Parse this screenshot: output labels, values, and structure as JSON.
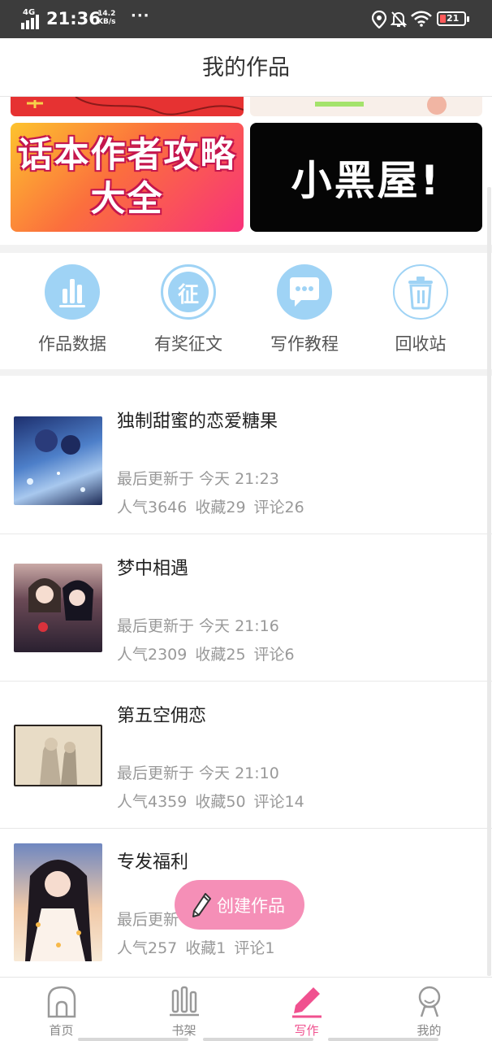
{
  "status_bar": {
    "network": "4G",
    "time": "21:36",
    "speed_value": "14.2",
    "speed_unit": "KB/s",
    "dots": "···",
    "battery": "21"
  },
  "header": {
    "title": "我的作品"
  },
  "banners": {
    "guide_line1": "话本作者攻略",
    "guide_line2": "大全",
    "dark_text": "小黑屋!"
  },
  "actions": [
    {
      "label": "作品数据",
      "icon": "bar-chart-icon"
    },
    {
      "label": "有奖征文",
      "icon": "contest-icon",
      "glyph": "征"
    },
    {
      "label": "写作教程",
      "icon": "chat-bubble-icon"
    },
    {
      "label": "回收站",
      "icon": "trash-icon"
    }
  ],
  "works": [
    {
      "title": "独制甜蜜的恋爱糖果",
      "updated": "最后更新于 今天 21:23",
      "popularity": "人气3646",
      "favorites": "收藏29",
      "comments": "评论26"
    },
    {
      "title": "梦中相遇",
      "updated": "最后更新于 今天 21:16",
      "popularity": "人气2309",
      "favorites": "收藏25",
      "comments": "评论6"
    },
    {
      "title": "第五空佣恋",
      "updated": "最后更新于 今天 21:10",
      "popularity": "人气4359",
      "favorites": "收藏50",
      "comments": "评论14"
    },
    {
      "title": "专发福利",
      "updated": "最后更新",
      "popularity": "人气257",
      "favorites": "收藏1",
      "comments": "评论1"
    }
  ],
  "fab": {
    "label": "创建作品"
  },
  "tabs": [
    {
      "label": "首页",
      "icon": "home-icon"
    },
    {
      "label": "书架",
      "icon": "bookshelf-icon"
    },
    {
      "label": "写作",
      "icon": "pen-icon"
    },
    {
      "label": "我的",
      "icon": "profile-icon"
    }
  ],
  "colors": {
    "accent_pink": "#f0518f",
    "fab_pink": "#f58fb7",
    "icon_blue": "#9fd3f5"
  }
}
